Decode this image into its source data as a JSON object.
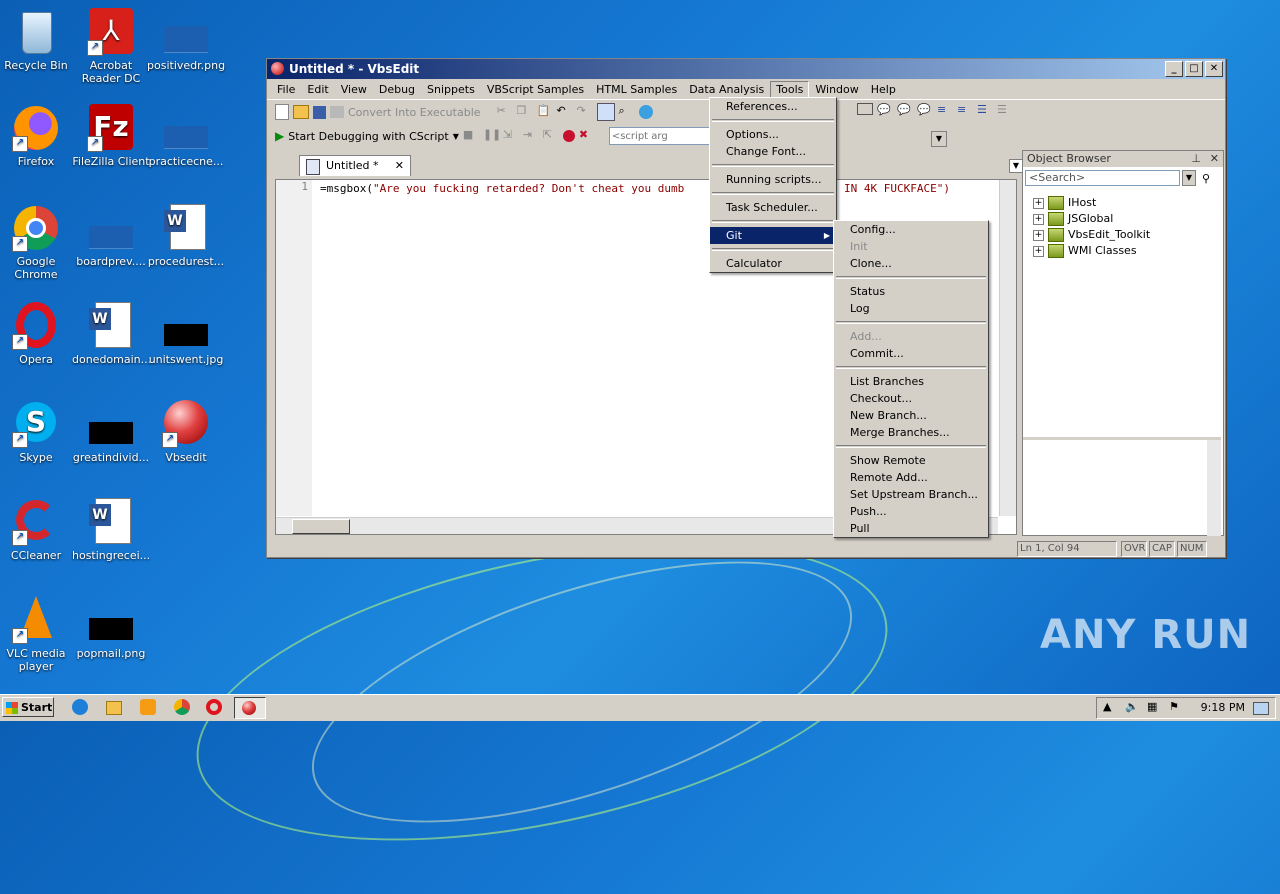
{
  "desktop": {
    "icons": [
      {
        "label": "Recycle Bin"
      },
      {
        "label": "Acrobat Reader DC"
      },
      {
        "label": "positivedr.png"
      },
      {
        "label": "Firefox"
      },
      {
        "label": "FileZilla Client"
      },
      {
        "label": "practicecne..."
      },
      {
        "label": "Google Chrome"
      },
      {
        "label": "boardprev...."
      },
      {
        "label": "procedurest..."
      },
      {
        "label": "Opera"
      },
      {
        "label": "donedomain..."
      },
      {
        "label": "unitswent.jpg"
      },
      {
        "label": "Skype"
      },
      {
        "label": "greatindivid..."
      },
      {
        "label": "Vbsedit"
      },
      {
        "label": "CCleaner"
      },
      {
        "label": "hostingrecei..."
      },
      {
        "label": "VLC media player"
      },
      {
        "label": "popmail.png"
      }
    ],
    "watermark": "ANY RUN"
  },
  "window": {
    "title": "Untitled * - VbsEdit",
    "controls": {
      "minimize": "_",
      "maximize": "□",
      "close": "✕"
    },
    "menu": [
      "File",
      "Edit",
      "View",
      "Debug",
      "Snippets",
      "VBScript Samples",
      "HTML Samples",
      "Data Analysis",
      "Tools",
      "Window",
      "Help"
    ],
    "active_menu": "Tools",
    "toolbar": {
      "convert_label": "Convert Into Executable",
      "debug_label": "Start Debugging with CScript",
      "script_args_placeholder": "<script arg"
    },
    "tab": {
      "label": "Untitled *"
    },
    "editor": {
      "line_number": "1",
      "code_prefix": "=msgbox(",
      "code_string_visible": "\"Are you fucking retarded? Don't cheat you dumb",
      "code_string_tail": "IN 4K FUCKFACE\")"
    },
    "object_browser": {
      "title": "Object Browser",
      "search_placeholder": "<Search>",
      "items": [
        "IHost",
        "JSGlobal",
        "VbsEdit_Toolkit",
        "WMI Classes"
      ]
    },
    "status": {
      "position": "Ln 1, Col 94",
      "ovr": "OVR",
      "cap": "CAP",
      "num": "NUM"
    }
  },
  "tools_menu": {
    "items": [
      {
        "label": "References..."
      },
      {
        "label": "Options..."
      },
      {
        "label": "Change Font..."
      },
      {
        "label": "Running scripts..."
      },
      {
        "label": "Task Scheduler..."
      },
      {
        "label": "Git"
      },
      {
        "label": "Calculator"
      }
    ]
  },
  "git_menu": {
    "items": [
      {
        "label": "Config...",
        "disabled": false
      },
      {
        "label": "Init",
        "disabled": true
      },
      {
        "label": "Clone...",
        "disabled": false
      },
      {
        "label": "Status",
        "disabled": false
      },
      {
        "label": "Log",
        "disabled": false
      },
      {
        "label": "Add...",
        "disabled": true
      },
      {
        "label": "Commit...",
        "disabled": false
      },
      {
        "label": "List Branches",
        "disabled": false
      },
      {
        "label": "Checkout...",
        "disabled": false
      },
      {
        "label": "New Branch...",
        "disabled": false
      },
      {
        "label": "Merge Branches...",
        "disabled": false
      },
      {
        "label": "Show Remote",
        "disabled": false
      },
      {
        "label": "Remote Add...",
        "disabled": false
      },
      {
        "label": "Set Upstream Branch...",
        "disabled": false
      },
      {
        "label": "Push...",
        "disabled": false
      },
      {
        "label": "Pull",
        "disabled": false
      }
    ]
  },
  "taskbar": {
    "start_label": "Start",
    "time": "9:18 PM"
  },
  "colors": {
    "titlebar_start": "#0a246a",
    "titlebar_end": "#a6caf0",
    "menu_highlight": "#0a246a",
    "desktop_bg": "#1577d2",
    "code_string": "#8b0000"
  }
}
